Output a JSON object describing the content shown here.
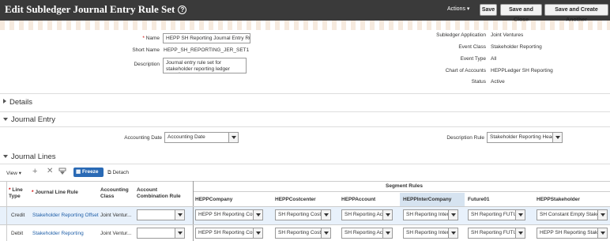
{
  "header": {
    "title": "Edit Subledger Journal Entry Rule Set",
    "actions_label": "Actions",
    "save_label": "Save",
    "save_close_label": "Save and Close",
    "save_create_label": "Save and Create Another"
  },
  "form": {
    "name_label": "Name",
    "name_value": "HEPP SH Reporting Journal Entry Rule",
    "short_name_label": "Short Name",
    "short_name_value": "HEPP_SH_REPORTING_JER_SET1",
    "description_label": "Description",
    "description_value": "Journal entry rule set for stakeholder reporting ledger mapping",
    "subledger_app_label": "Subledger Application",
    "subledger_app_value": "Joint Ventures",
    "event_class_label": "Event Class",
    "event_class_value": "Stakeholder Reporting",
    "event_type_label": "Event Type",
    "event_type_value": "All",
    "chart_accounts_label": "Chart of Accounts",
    "chart_accounts_value": "HEPPLedger SH Reporting",
    "status_label": "Status",
    "status_value": "Active"
  },
  "sections": {
    "details": "Details",
    "journal_entry": "Journal Entry",
    "journal_lines": "Journal Lines"
  },
  "journal_entry": {
    "accounting_date_label": "Accounting Date",
    "accounting_date_value": "Accounting Date",
    "description_rule_label": "Description Rule",
    "description_rule_value": "Stakeholder Reporting Heade"
  },
  "toolbar": {
    "view_label": "View",
    "freeze_label": "Freeze",
    "detach_label": "Detach"
  },
  "table": {
    "col_line_type": "Line Type",
    "col_journal_line_rule": "Journal Line Rule",
    "col_accounting_class": "Accounting Class",
    "col_account_combo": "Account Combination Rule",
    "segment_rules_label": "Segment Rules",
    "segments": [
      "HEPPCompany",
      "HEPPCostcenter",
      "HEPPAccount",
      "HEPPInterCompany",
      "Future01",
      "HEPPStakeholder"
    ],
    "rows": [
      {
        "line_type": "Credit",
        "journal_line_rule": "Stakeholder Reporting Offset",
        "accounting_class": "Joint Ventur...",
        "account_combo": "",
        "segments": [
          "HEPP SH Reporting Com",
          "SH Reporting Costc",
          "SH Reporting Acc",
          "SH Reporting Inter",
          "SH Reporting FUTU",
          "SH Constant Empty Stake"
        ]
      },
      {
        "line_type": "Debit",
        "journal_line_rule": "Stakeholder Reporting",
        "accounting_class": "Joint Ventur...",
        "account_combo": "",
        "segments": [
          "HEPP SH Reporting Com",
          "SH Reporting Costc",
          "SH Reporting Acc",
          "SH Reporting Inter",
          "SH Reporting FUTU",
          "HEPP SH Reporting Stake"
        ]
      }
    ]
  }
}
